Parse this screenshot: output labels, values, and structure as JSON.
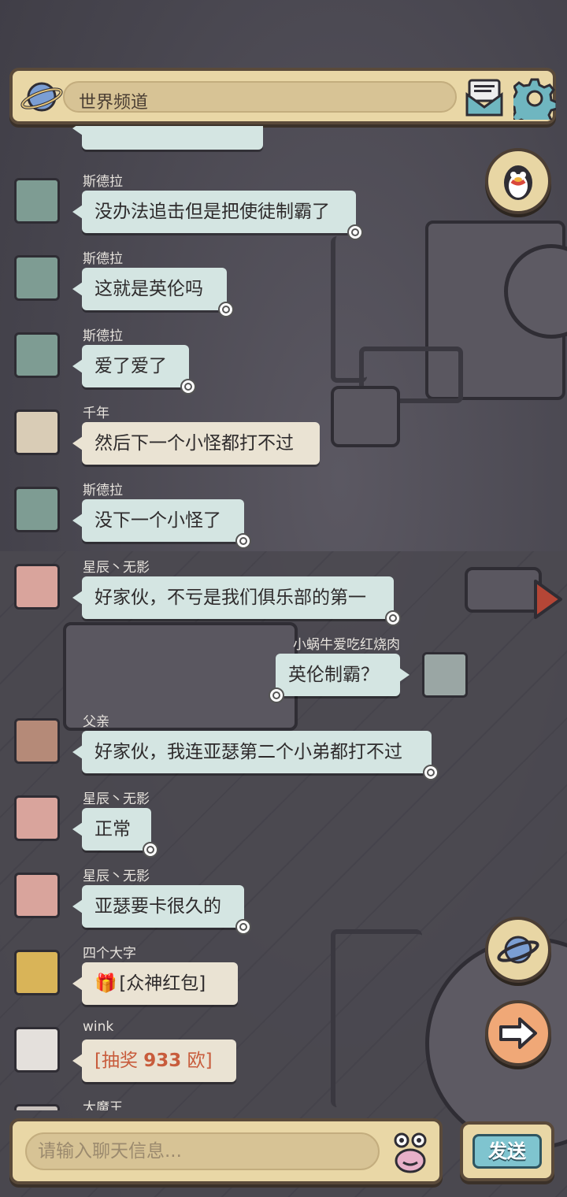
{
  "header": {
    "title": "世界频道"
  },
  "messages": [
    {
      "user": "斯德拉",
      "text": "没办法追击但是把使徒制霸了"
    },
    {
      "user": "斯德拉",
      "text": "这就是英伦吗"
    },
    {
      "user": "斯德拉",
      "text": "爱了爱了"
    },
    {
      "user": "千年",
      "text": "然后下一个小怪都打不过"
    },
    {
      "user": "斯德拉",
      "text": "没下一个小怪了"
    },
    {
      "user": "星辰丶无影",
      "text": "好家伙，不亏是我们俱乐部的第一"
    },
    {
      "user": "小蜗牛爱吃红烧肉",
      "text": "英伦制霸？"
    },
    {
      "user": "父亲",
      "text": "好家伙，我连亚瑟第二个小弟都打不过"
    },
    {
      "user": "星辰丶无影",
      "text": "正常"
    },
    {
      "user": "星辰丶无影",
      "text": "亚瑟要卡很久的"
    },
    {
      "user": "四个大字",
      "text": "[众神红包]"
    },
    {
      "user": "wink",
      "text_open": "[抽奖 ",
      "amount": "933",
      "text_close": " 欧]"
    },
    {
      "user": "大魔王"
    }
  ],
  "footer": {
    "placeholder": "请输入聊天信息...",
    "send_label": "发送"
  },
  "colors": {
    "bubble_self": "#d4e5e2",
    "bubble_other": "#eae3d3",
    "panel": "#e9d7a6",
    "lottery": "#c85c3c"
  }
}
